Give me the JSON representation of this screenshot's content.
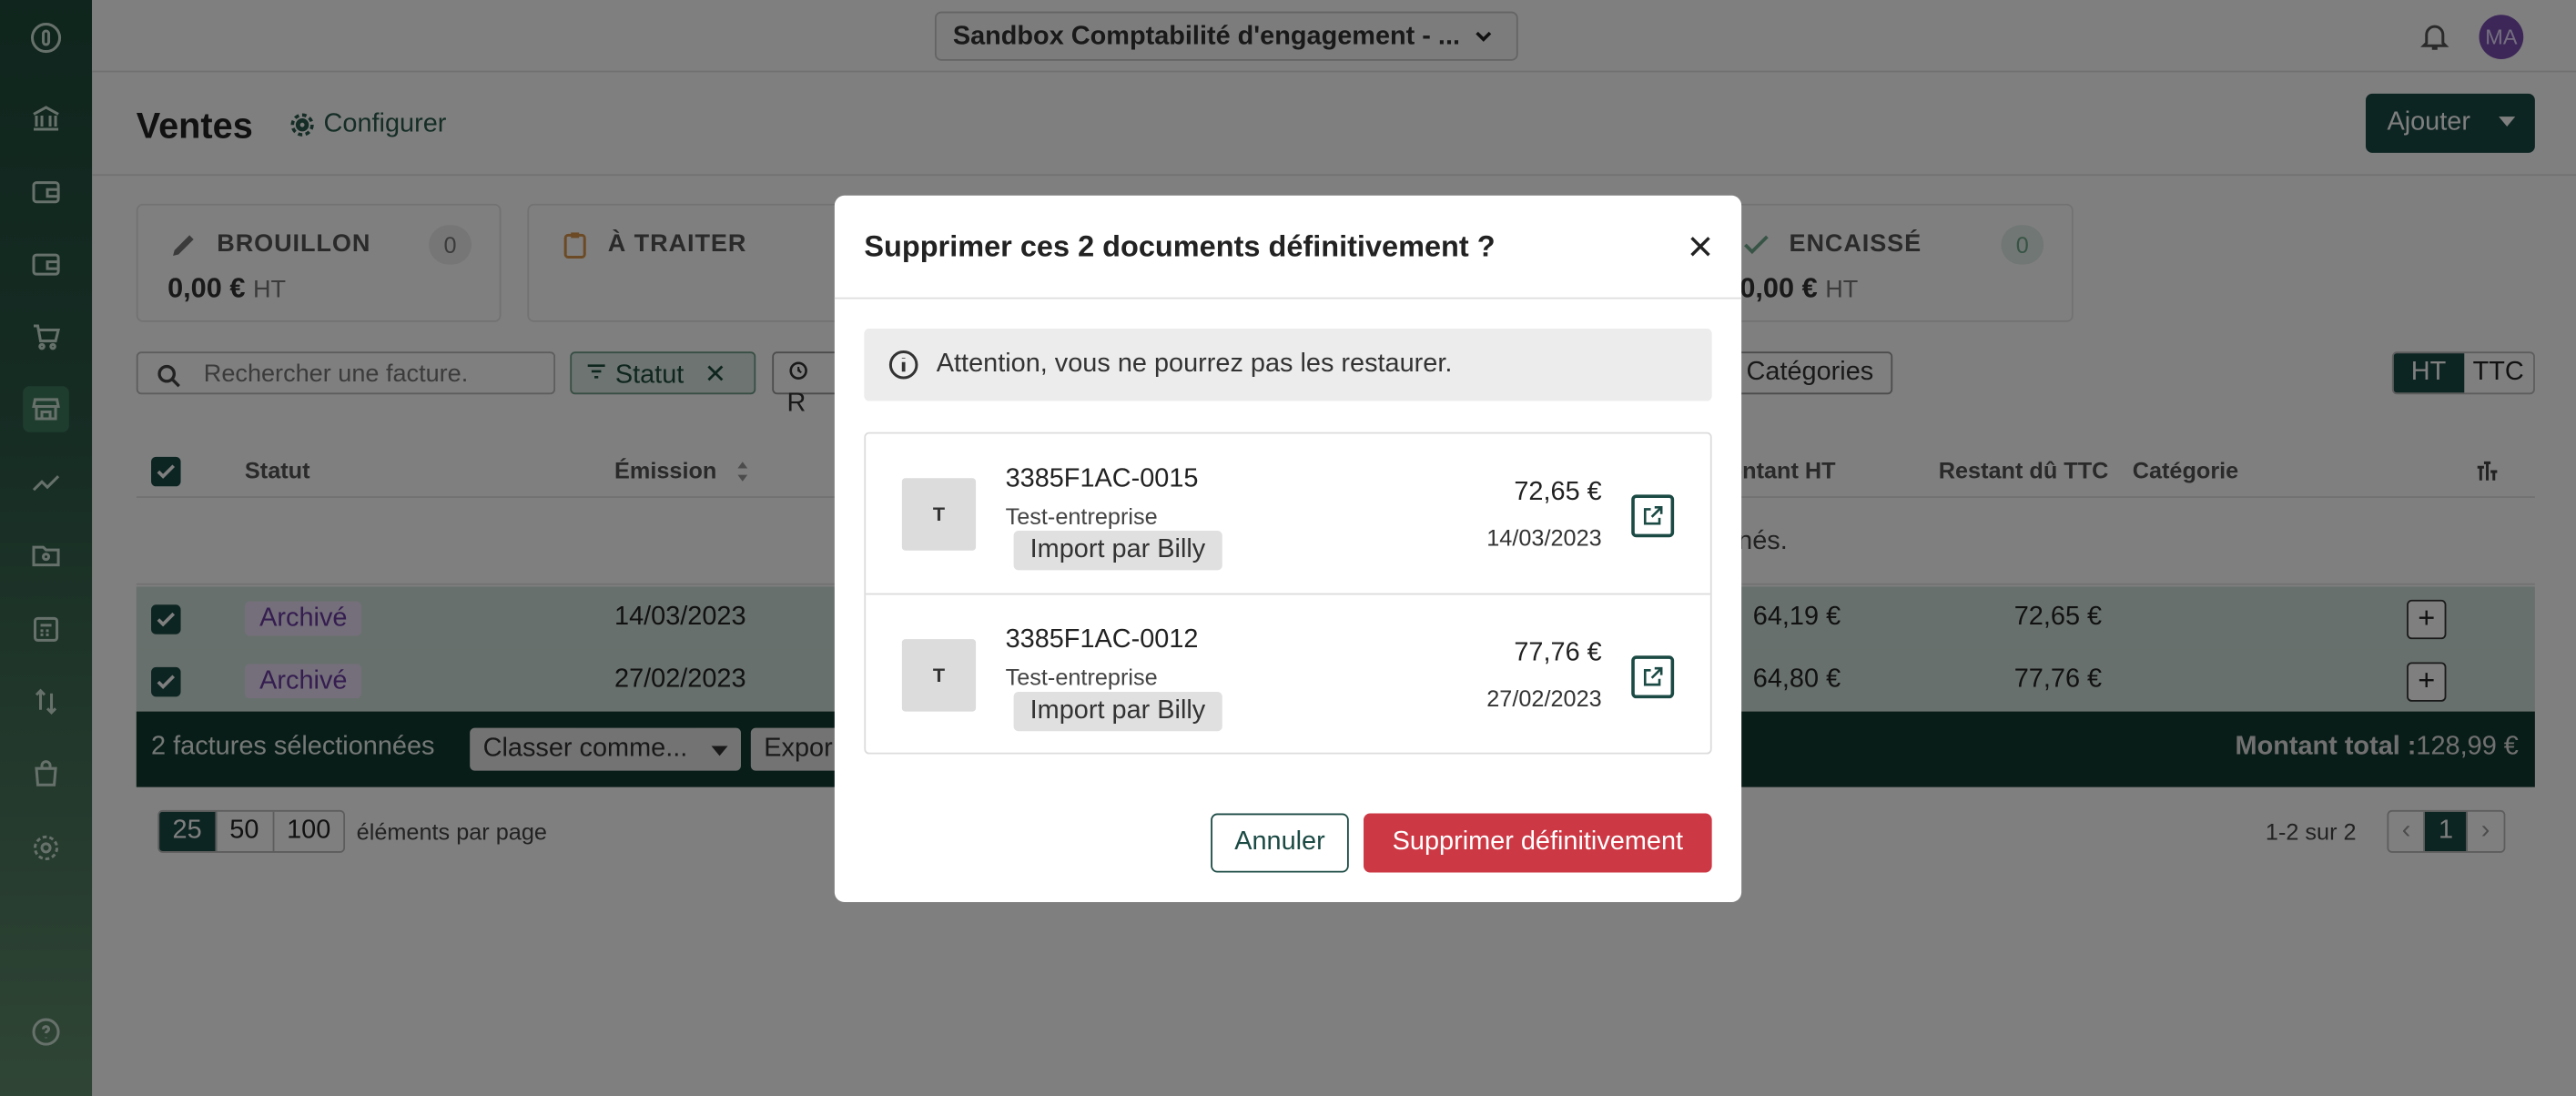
{
  "topbar": {
    "org_name": "Sandbox Comptabilité d'engagement - ...",
    "avatar_initials": "MA"
  },
  "sidebar": {
    "items": [
      "logo-icon",
      "bank-icon",
      "wallet-icon",
      "wallet-alt-icon",
      "cart-icon",
      "store-icon",
      "chart-icon",
      "folder-user-icon",
      "calculator-icon",
      "transfer-icon",
      "bag-icon",
      "gear-icon",
      "help-icon"
    ]
  },
  "header": {
    "title": "Ventes",
    "configure_label": "Configurer",
    "add_label": "Ajouter"
  },
  "cards": [
    {
      "label": "BROUILLON",
      "amount": "0,00 €",
      "unit": "HT",
      "count": "0"
    },
    {
      "label": "À TRAITER",
      "count": ""
    },
    {
      "label": "ENCAISSÉ",
      "amount": "0,00 €",
      "unit": "HT",
      "count": "0"
    }
  ],
  "filters": {
    "search_placeholder": "Rechercher une facture.",
    "status_chip": "Statut",
    "partial_chip": "R",
    "categories_chip": "Catégories",
    "toggle": [
      "HT",
      "TTC"
    ]
  },
  "table": {
    "headers": {
      "status": "Statut",
      "emission": "Émission",
      "montant_ht": "ontant HT",
      "restant": "Restant dû TTC",
      "categorie": "Catégorie"
    },
    "empty_partial": "onnés.",
    "rows": [
      {
        "status": "Archivé",
        "date": "14/03/2023",
        "montant_ht": "64,19 €",
        "restant": "72,65 €"
      },
      {
        "status": "Archivé",
        "date": "27/02/2023",
        "montant_ht": "64,80 €",
        "restant": "77,76 €"
      }
    ]
  },
  "selection_bar": {
    "text": "2 factures sélectionnées",
    "classify": "Classer comme...",
    "export": "Expor",
    "total_label": "Montant total :",
    "total_value": "128,99 €"
  },
  "pagination": {
    "sizes": [
      "25",
      "50",
      "100"
    ],
    "per_page_label": "éléments par page",
    "range": "1-2 sur 2",
    "current": "1"
  },
  "modal": {
    "title": "Supprimer ces 2 documents définitivement ?",
    "warning": "Attention, vous ne pourrez pas les restaurer.",
    "documents": [
      {
        "thumb": "T",
        "ref": "3385F1AC-0015",
        "customer": "Test-entreprise",
        "tag": "Import par Billy",
        "amount": "72,65 €",
        "date": "14/03/2023"
      },
      {
        "thumb": "T",
        "ref": "3385F1AC-0012",
        "customer": "Test-entreprise",
        "tag": "Import par Billy",
        "amount": "77,76 €",
        "date": "27/02/2023"
      }
    ],
    "cancel_label": "Annuler",
    "delete_label": "Supprimer définitivement"
  },
  "colors": {
    "primary": "#1b4a44",
    "danger": "#cc3844",
    "row_selected": "#cfe1d8",
    "archived_badge": "#e8def4"
  }
}
